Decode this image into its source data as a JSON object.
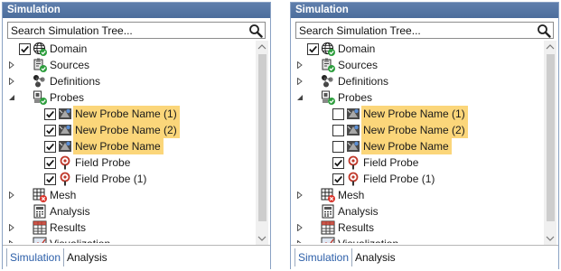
{
  "panels": [
    {
      "title": "Simulation",
      "search_placeholder": "Search Simulation Tree...",
      "tree": [
        {
          "label": "Domain",
          "expander": "none",
          "checked": true,
          "icon": "globe-icon"
        },
        {
          "label": "Sources",
          "expander": "collapsed",
          "icon": "sources-icon"
        },
        {
          "label": "Definitions",
          "expander": "collapsed",
          "icon": "definitions-icon"
        },
        {
          "label": "Probes",
          "expander": "expanded",
          "icon": "probes-icon"
        },
        {
          "label": "New Probe Name (1)",
          "checked": true,
          "selected": true,
          "icon": "probe-icon"
        },
        {
          "label": "New Probe Name (2)",
          "checked": true,
          "selected": true,
          "icon": "probe-icon"
        },
        {
          "label": "New Probe Name",
          "checked": true,
          "selected": true,
          "icon": "probe-icon"
        },
        {
          "label": "Field Probe",
          "checked": true,
          "selected": false,
          "icon": "field-probe-icon"
        },
        {
          "label": "Field Probe (1)",
          "checked": true,
          "selected": false,
          "icon": "field-probe-icon"
        },
        {
          "label": "Mesh",
          "expander": "collapsed",
          "icon": "mesh-error-icon"
        },
        {
          "label": "Analysis",
          "expander": "none",
          "icon": "analysis-icon"
        },
        {
          "label": "Results",
          "expander": "collapsed",
          "icon": "results-icon"
        },
        {
          "label": "Visualization",
          "expander": "collapsed",
          "icon": "visualization-icon"
        }
      ],
      "tabs": [
        {
          "label": "Simulation",
          "active": true
        },
        {
          "label": "Analysis",
          "active": false
        }
      ]
    },
    {
      "title": "Simulation",
      "search_placeholder": "Search Simulation Tree...",
      "tree": [
        {
          "label": "Domain",
          "expander": "none",
          "checked": true,
          "icon": "globe-icon"
        },
        {
          "label": "Sources",
          "expander": "collapsed",
          "icon": "sources-icon"
        },
        {
          "label": "Definitions",
          "expander": "collapsed",
          "icon": "definitions-icon"
        },
        {
          "label": "Probes",
          "expander": "expanded",
          "icon": "probes-icon"
        },
        {
          "label": "New Probe Name (1)",
          "checked": false,
          "selected": true,
          "icon": "probe-icon"
        },
        {
          "label": "New Probe Name (2)",
          "checked": false,
          "selected": true,
          "icon": "probe-icon"
        },
        {
          "label": "New Probe Name",
          "checked": false,
          "selected": true,
          "icon": "probe-icon"
        },
        {
          "label": "Field Probe",
          "checked": true,
          "selected": false,
          "icon": "field-probe-icon"
        },
        {
          "label": "Field Probe (1)",
          "checked": true,
          "selected": false,
          "icon": "field-probe-icon"
        },
        {
          "label": "Mesh",
          "expander": "collapsed",
          "icon": "mesh-error-icon"
        },
        {
          "label": "Analysis",
          "expander": "none",
          "icon": "analysis-icon"
        },
        {
          "label": "Results",
          "expander": "collapsed",
          "icon": "results-icon"
        },
        {
          "label": "Visualization",
          "expander": "collapsed",
          "icon": "visualization-icon"
        }
      ],
      "tabs": [
        {
          "label": "Simulation",
          "active": true
        },
        {
          "label": "Analysis",
          "active": false
        }
      ]
    }
  ],
  "colors": {
    "titlebar": "#5274a3",
    "selection": "#fbd67a",
    "active_tab": "#2b5ea8",
    "check_badge": "#2e9e3e",
    "error_badge": "#d9342b"
  }
}
